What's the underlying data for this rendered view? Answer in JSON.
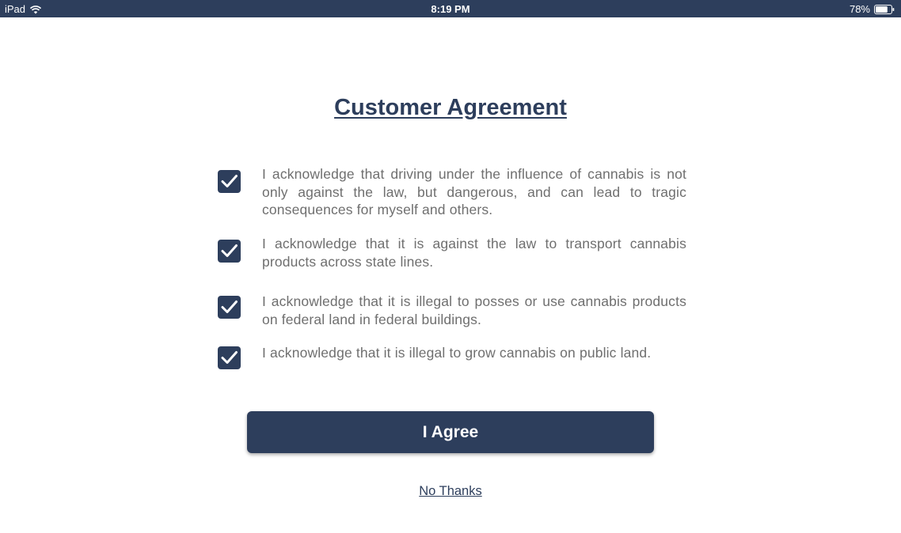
{
  "status_bar": {
    "device": "iPad",
    "time": "8:19 PM",
    "battery": "78%",
    "battery_level": 0.78,
    "icons": [
      "wifi-icon",
      "battery-icon"
    ]
  },
  "title": "Customer Agreement",
  "agreements": [
    {
      "checked": true,
      "text": "I acknowledge that driving under the influence of cannabis is not only against the law, but dangerous, and can lead to tragic consequences for myself and others."
    },
    {
      "checked": true,
      "text": "I acknowledge that it is against the law to transport cannabis products across state lines."
    },
    {
      "checked": true,
      "text": "I acknowledge that it is illegal to posses or use cannabis products on federal land in federal buildings."
    },
    {
      "checked": true,
      "text": "I acknowledge that it is illegal to grow cannabis on public land."
    }
  ],
  "agree_button": "I Agree",
  "no_thanks_link": "No Thanks",
  "colors": {
    "primary": "#2d3e5c",
    "body_text": "#6f6f6f",
    "background": "#ffffff"
  }
}
